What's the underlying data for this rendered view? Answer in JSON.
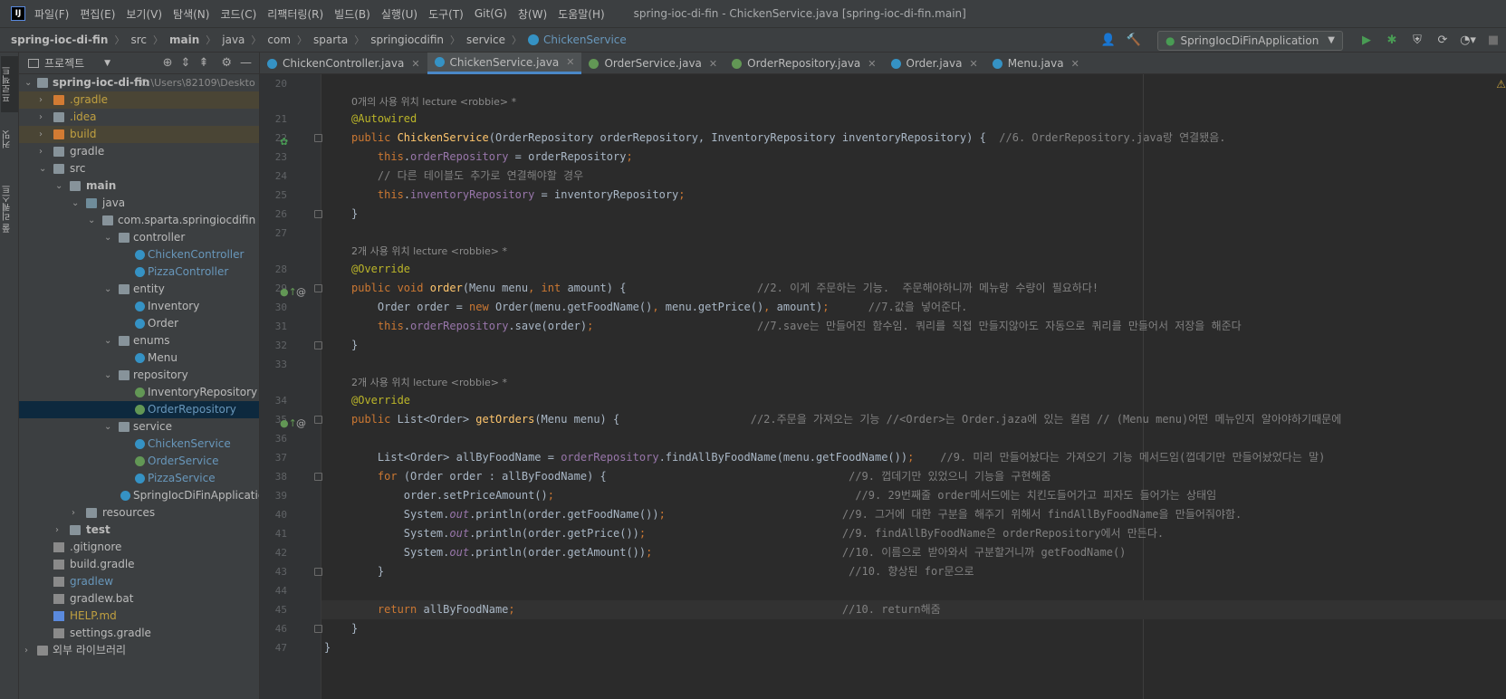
{
  "menubar": {
    "items": [
      "파일(F)",
      "편집(E)",
      "보기(V)",
      "탐색(N)",
      "코드(C)",
      "리팩터링(R)",
      "빌드(B)",
      "실행(U)",
      "도구(T)",
      "Git(G)",
      "창(W)",
      "도움말(H)"
    ],
    "window_title": "spring-ioc-di-fin - ChickenService.java [spring-ioc-di-fin.main]"
  },
  "breadcrumbs": [
    "spring-ioc-di-fin",
    "src",
    "main",
    "java",
    "com",
    "sparta",
    "springiocdifin",
    "service",
    "ChickenService"
  ],
  "run_config": "SpringIocDiFinApplication",
  "left_strip": {
    "tab1": "프로젝트",
    "tab2": "커밋",
    "tab3": "풀 리퀘스트"
  },
  "project_panel": {
    "title": "프로젝트",
    "root_name": "spring-ioc-di-fin",
    "root_path": "C:\\Users\\82109\\Deskto",
    "nodes": [
      ".gradle",
      ".idea",
      "build",
      "gradle",
      "src",
      "main",
      "java",
      "com.sparta.springiocdifin",
      "controller",
      "ChickenController",
      "PizzaController",
      "entity",
      "Inventory",
      "Order",
      "enums",
      "Menu",
      "repository",
      "InventoryRepository",
      "OrderRepository",
      "service",
      "ChickenService",
      "OrderService",
      "PizzaService",
      "SpringIocDiFinApplication",
      "resources",
      "test",
      ".gitignore",
      "build.gradle",
      "gradlew",
      "gradlew.bat",
      "HELP.md",
      "settings.gradle",
      "외부 라이브러리"
    ]
  },
  "tabs": [
    "ChickenController.java",
    "ChickenService.java",
    "OrderService.java",
    "OrderRepository.java",
    "Order.java",
    "Menu.java"
  ],
  "editor": {
    "hint1": "0개의 사용 위치   lecture <robbie> *",
    "hint2": "2개 사용 위치   lecture <robbie> *",
    "hint3": "2개 사용 위치   lecture <robbie> *",
    "line_numbers": [
      "20",
      "21",
      "22",
      "23",
      "24",
      "25",
      "26",
      "27",
      "28",
      "29",
      "30",
      "31",
      "32",
      "33",
      "34",
      "35",
      "36",
      "37",
      "38",
      "39",
      "40",
      "41",
      "42",
      "43",
      "44",
      "45",
      "46",
      "47"
    ],
    "comments": {
      "c22": "//6. OrderRepository.java랑 연결됐음.",
      "c24": "// 다른 테이블도 추가로 연결해야할 경우",
      "c29": "//2. 이게 주문하는 기능.  주문해야하니까 메뉴랑 수량이 필요하다!",
      "c30": "//7.값을 넣어준다.",
      "c31": "//7.save는 만들어진 함수임. 쿼리를 직접 만들지않아도 자동으로 쿼리를 만들어서 저장을 해준다",
      "c35": "//2.주문을 가져오는 기능 //<Order>는 Order.jaza에 있는 컬럼 // (Menu menu)어떤 메뉴인지 알아야하기때문에",
      "c37": "//9. 미리 만들어놨다는 가져오기 기능 메서드임(껍데기만 만들어놨었다는 말)",
      "c38": "//9. 껍데기만 있었으니 기능을 구현해줌",
      "c39": "//9. 29번째줄 order메서드에는 치킨도들어가고 피자도 들어가는 상태임",
      "c40": "//9. 그거에 대한 구분을 해주기 위해서 findAllByFoodName을 만들어줘야함.",
      "c41": "//9. findAllByFoodName은 orderRepository에서 만든다.",
      "c42": "//10. 이름으로 받아와서 구분할거니까 getFoodName()",
      "c43": "//10. 향상된 for문으로",
      "c45": "//10. return해줌"
    }
  }
}
